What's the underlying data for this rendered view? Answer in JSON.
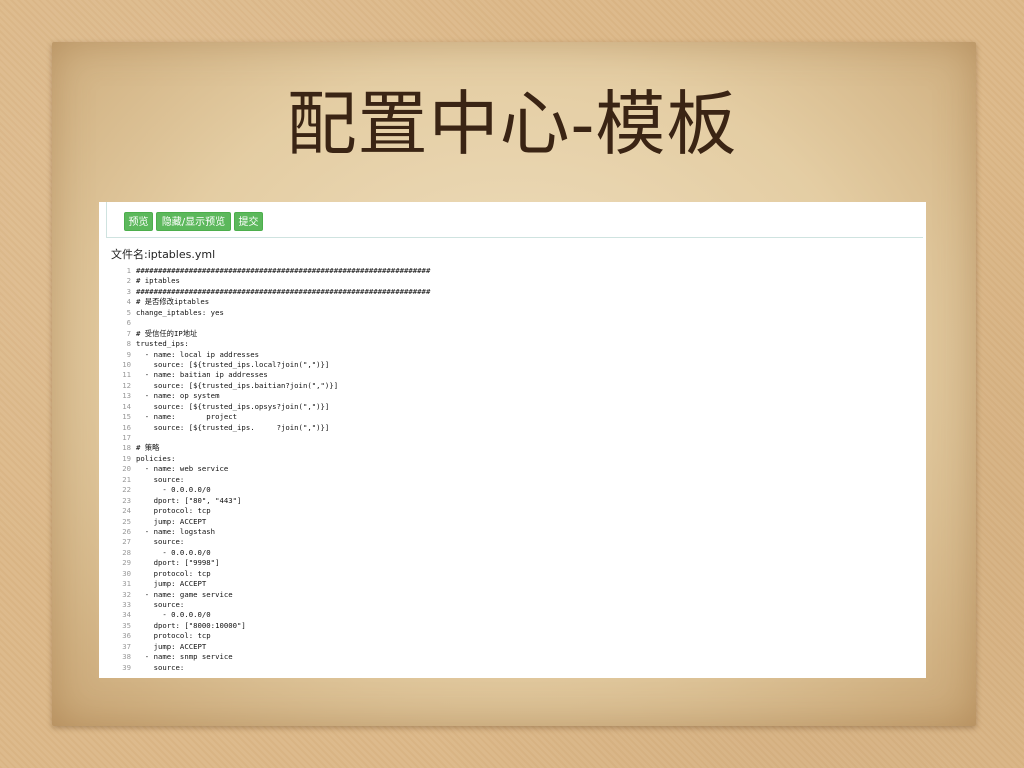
{
  "slide": {
    "title": "配置中心-模板"
  },
  "toolbar": {
    "preview_label": "预览",
    "toggle_label": "隐藏/显示预览",
    "submit_label": "提交"
  },
  "file": {
    "label": "文件名:",
    "name": "iptables.yml"
  },
  "code_lines": [
    "###################################################################",
    "# iptables",
    "###################################################################",
    "# 是否修改iptables",
    "change_iptables: yes",
    "",
    "# 受信任的IP地址",
    "trusted_ips:",
    "  - name: local ip addresses",
    "    source: [${trusted_ips.local?join(\",\")}]",
    "  - name: baitian ip addresses",
    "    source: [${trusted_ips.baitian?join(\",\")}]",
    "  - name: op system",
    "    source: [${trusted_ips.opsys?join(\",\")}]",
    "  - name:       project",
    "    source: [${trusted_ips.     ?join(\",\")}]",
    "",
    "# 策略",
    "policies:",
    "  - name: web service",
    "    source:",
    "      - 0.0.0.0/0",
    "    dport: [\"80\", \"443\"]",
    "    protocol: tcp",
    "    jump: ACCEPT",
    "  - name: logstash",
    "    source:",
    "      - 0.0.0.0/0",
    "    dport: [\"9998\"]",
    "    protocol: tcp",
    "    jump: ACCEPT",
    "  - name: game service",
    "    source:",
    "      - 0.0.0.0/0",
    "    dport: [\"8000:10000\"]",
    "    protocol: tcp",
    "    jump: ACCEPT",
    "  - name: snmp service",
    "    source:"
  ]
}
